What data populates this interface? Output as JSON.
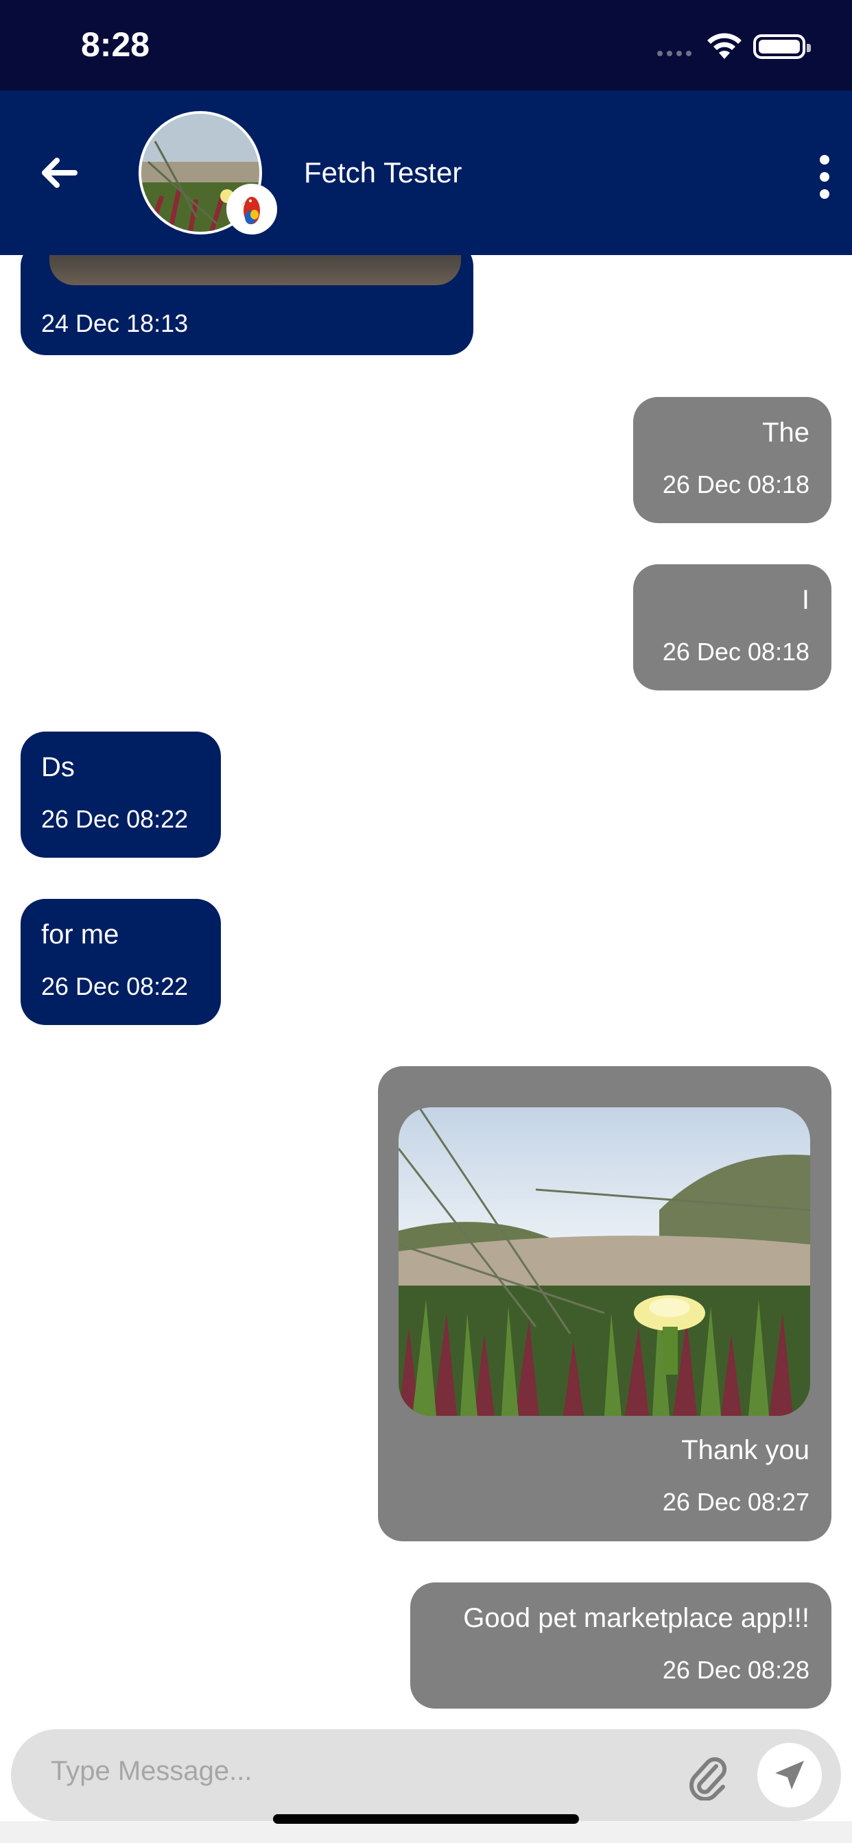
{
  "status_bar": {
    "time": "8:28"
  },
  "header": {
    "contact_name": "Fetch Tester"
  },
  "messages": [
    {
      "direction": "incoming",
      "text": "",
      "time": "24 Dec 18:13",
      "has_image": true,
      "partial": true
    },
    {
      "direction": "outgoing",
      "text": "The",
      "time": "26 Dec 08:18"
    },
    {
      "direction": "outgoing",
      "text": "I",
      "time": "26 Dec 08:18"
    },
    {
      "direction": "incoming",
      "text": "Ds",
      "time": "26 Dec 08:22"
    },
    {
      "direction": "incoming",
      "text": "for me",
      "time": "26 Dec 08:22"
    },
    {
      "direction": "outgoing",
      "text": "Thank you",
      "time": "26 Dec 08:27",
      "has_image": true
    },
    {
      "direction": "outgoing",
      "text": "Good pet marketplace app!!!",
      "time": "26 Dec 08:28"
    }
  ],
  "composer": {
    "placeholder": "Type Message..."
  },
  "icons": {
    "back": "arrow-left-icon",
    "menu": "more-vertical-icon",
    "attach": "paperclip-icon",
    "send": "send-icon"
  },
  "colors": {
    "header": "#001e62",
    "status_bar": "#070b3a",
    "incoming_bubble": "#001e62",
    "outgoing_bubble": "#808080"
  }
}
